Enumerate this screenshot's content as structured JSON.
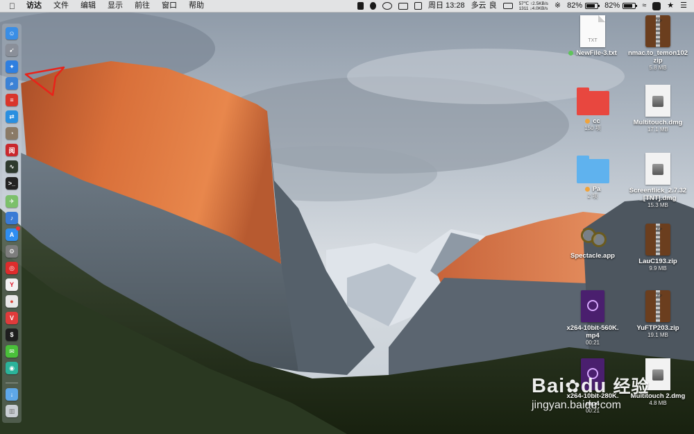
{
  "menubar": {
    "apple_icon": "apple-icon",
    "menus": [
      "访达",
      "文件",
      "编辑",
      "显示",
      "前往",
      "窗口",
      "帮助"
    ],
    "status": {
      "weekday": "周日",
      "time": "13:28",
      "weather": "多云",
      "air_quality": "良",
      "net_temp": "57℃",
      "net_up": "↑2.5KB/s",
      "net_rpm": "1311",
      "net_down": "↓4.0KB/s",
      "battery_percent_a": "82%",
      "battery_percent_b": "82%"
    }
  },
  "dock": {
    "apps": [
      {
        "name": "finder-icon",
        "color": "#3a8ee6"
      },
      {
        "name": "launchpad-icon",
        "color": "#8a8f99"
      },
      {
        "name": "safari-icon",
        "color": "#2f7fe0"
      },
      {
        "name": "preview-search-icon",
        "color": "#3b82d6"
      },
      {
        "name": "app-red-icon",
        "color": "#d9362b"
      },
      {
        "name": "teamviewer-icon",
        "color": "#2a8fe0"
      },
      {
        "name": "dashboard-icon",
        "color": "#8a7a66"
      },
      {
        "name": "app-chinese-red-icon",
        "color": "#c9282d"
      },
      {
        "name": "activity-monitor-icon",
        "color": "#2e3a2e"
      },
      {
        "name": "terminal-icon",
        "color": "#222222"
      },
      {
        "name": "maps-icon",
        "color": "#7cc06b"
      },
      {
        "name": "microphone-app-icon",
        "color": "#3a7bd5"
      },
      {
        "name": "app-store-icon",
        "color": "#2f8ef0"
      },
      {
        "name": "system-preferences-icon",
        "color": "#7d7d7d"
      },
      {
        "name": "netease-music-icon",
        "color": "#dd2c2c"
      },
      {
        "name": "yandex-browser-icon",
        "color": "#f2f2f2"
      },
      {
        "name": "chrome-icon",
        "color": "#e8e8e8"
      },
      {
        "name": "vivaldi-icon",
        "color": "#e03b3b"
      },
      {
        "name": "iterm-icon",
        "color": "#1e1e1e"
      },
      {
        "name": "wechat-icon",
        "color": "#4ac03a"
      },
      {
        "name": "app-green-icon",
        "color": "#2bb39a"
      },
      {
        "name": "downloads-folder-icon",
        "color": "#5ea7e8"
      },
      {
        "name": "trash-icon",
        "color": "#c9ced3"
      }
    ]
  },
  "desktop": {
    "items": [
      {
        "label": "NewFile-3.txt",
        "sub": "",
        "kind": "txt",
        "ext": "TXT",
        "tag": "#5fc45a"
      },
      {
        "label": "nmac.to_temon102",
        "label2": "zip",
        "sub": "5.8 MB",
        "kind": "zip",
        "tag": ""
      },
      {
        "label": "cc",
        "sub": "150 项",
        "kind": "folder",
        "color": "#e8473f",
        "tag": "#f0a33a"
      },
      {
        "label": "Multitouch.dmg",
        "sub": "17.1 MB",
        "kind": "dmg",
        "tag": ""
      },
      {
        "label": "Pa",
        "sub": "2 项",
        "kind": "folder",
        "color": "#5fb2ee",
        "tag": "#f0a33a"
      },
      {
        "label": "Screenflick_2.7.32",
        "label2": "_[TNT].dmg",
        "sub": "15.3 MB",
        "kind": "dmg",
        "tag": ""
      },
      {
        "label": "Spectacle.app",
        "sub": "",
        "kind": "app",
        "tag": ""
      },
      {
        "label": "LauC193.zip",
        "sub": "9.9 MB",
        "kind": "zip",
        "tag": ""
      },
      {
        "label": "x264-10bit-560K.",
        "label2": "mp4",
        "sub": "00:21",
        "kind": "mp4",
        "tag": ""
      },
      {
        "label": "YuFTP203.zip",
        "sub": "19.1 MB",
        "kind": "zip",
        "tag": ""
      },
      {
        "label": "x264-10bit-280K.",
        "label2": "mp4",
        "sub": "00:21",
        "kind": "mp4",
        "tag": ""
      },
      {
        "label": "Multitouch 2.dmg",
        "sub": "4.8 MB",
        "kind": "dmg",
        "tag": ""
      }
    ]
  },
  "watermark": {
    "brand": "Bai",
    "brand2": "du",
    "brand_cn": "经验",
    "url": "jingyan.baidu.com"
  }
}
